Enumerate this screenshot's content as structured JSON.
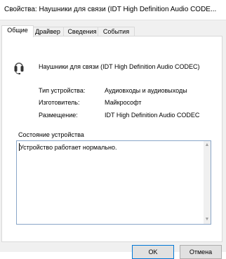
{
  "window": {
    "title": "Свойства: Наушники для связи (IDT High Definition Audio CODE..."
  },
  "tabs": [
    {
      "label": "Общие",
      "active": true
    },
    {
      "label": "Драйвер",
      "active": false
    },
    {
      "label": "Сведения",
      "active": false
    },
    {
      "label": "События",
      "active": false
    }
  ],
  "device": {
    "icon": "headset-icon",
    "name": "Наушники для связи (IDT High Definition Audio CODEC)"
  },
  "properties": [
    {
      "label": "Тип устройства:",
      "value": "Аудиовходы и аудиовыходы"
    },
    {
      "label": "Изготовитель:",
      "value": "Майкрософт"
    },
    {
      "label": "Размещение:",
      "value": "IDT High Definition Audio CODEC"
    }
  ],
  "status": {
    "group_label": "Состояние устройства",
    "text": "Устройство работает нормально."
  },
  "buttons": {
    "ok": "OK",
    "cancel": "Отмена"
  }
}
